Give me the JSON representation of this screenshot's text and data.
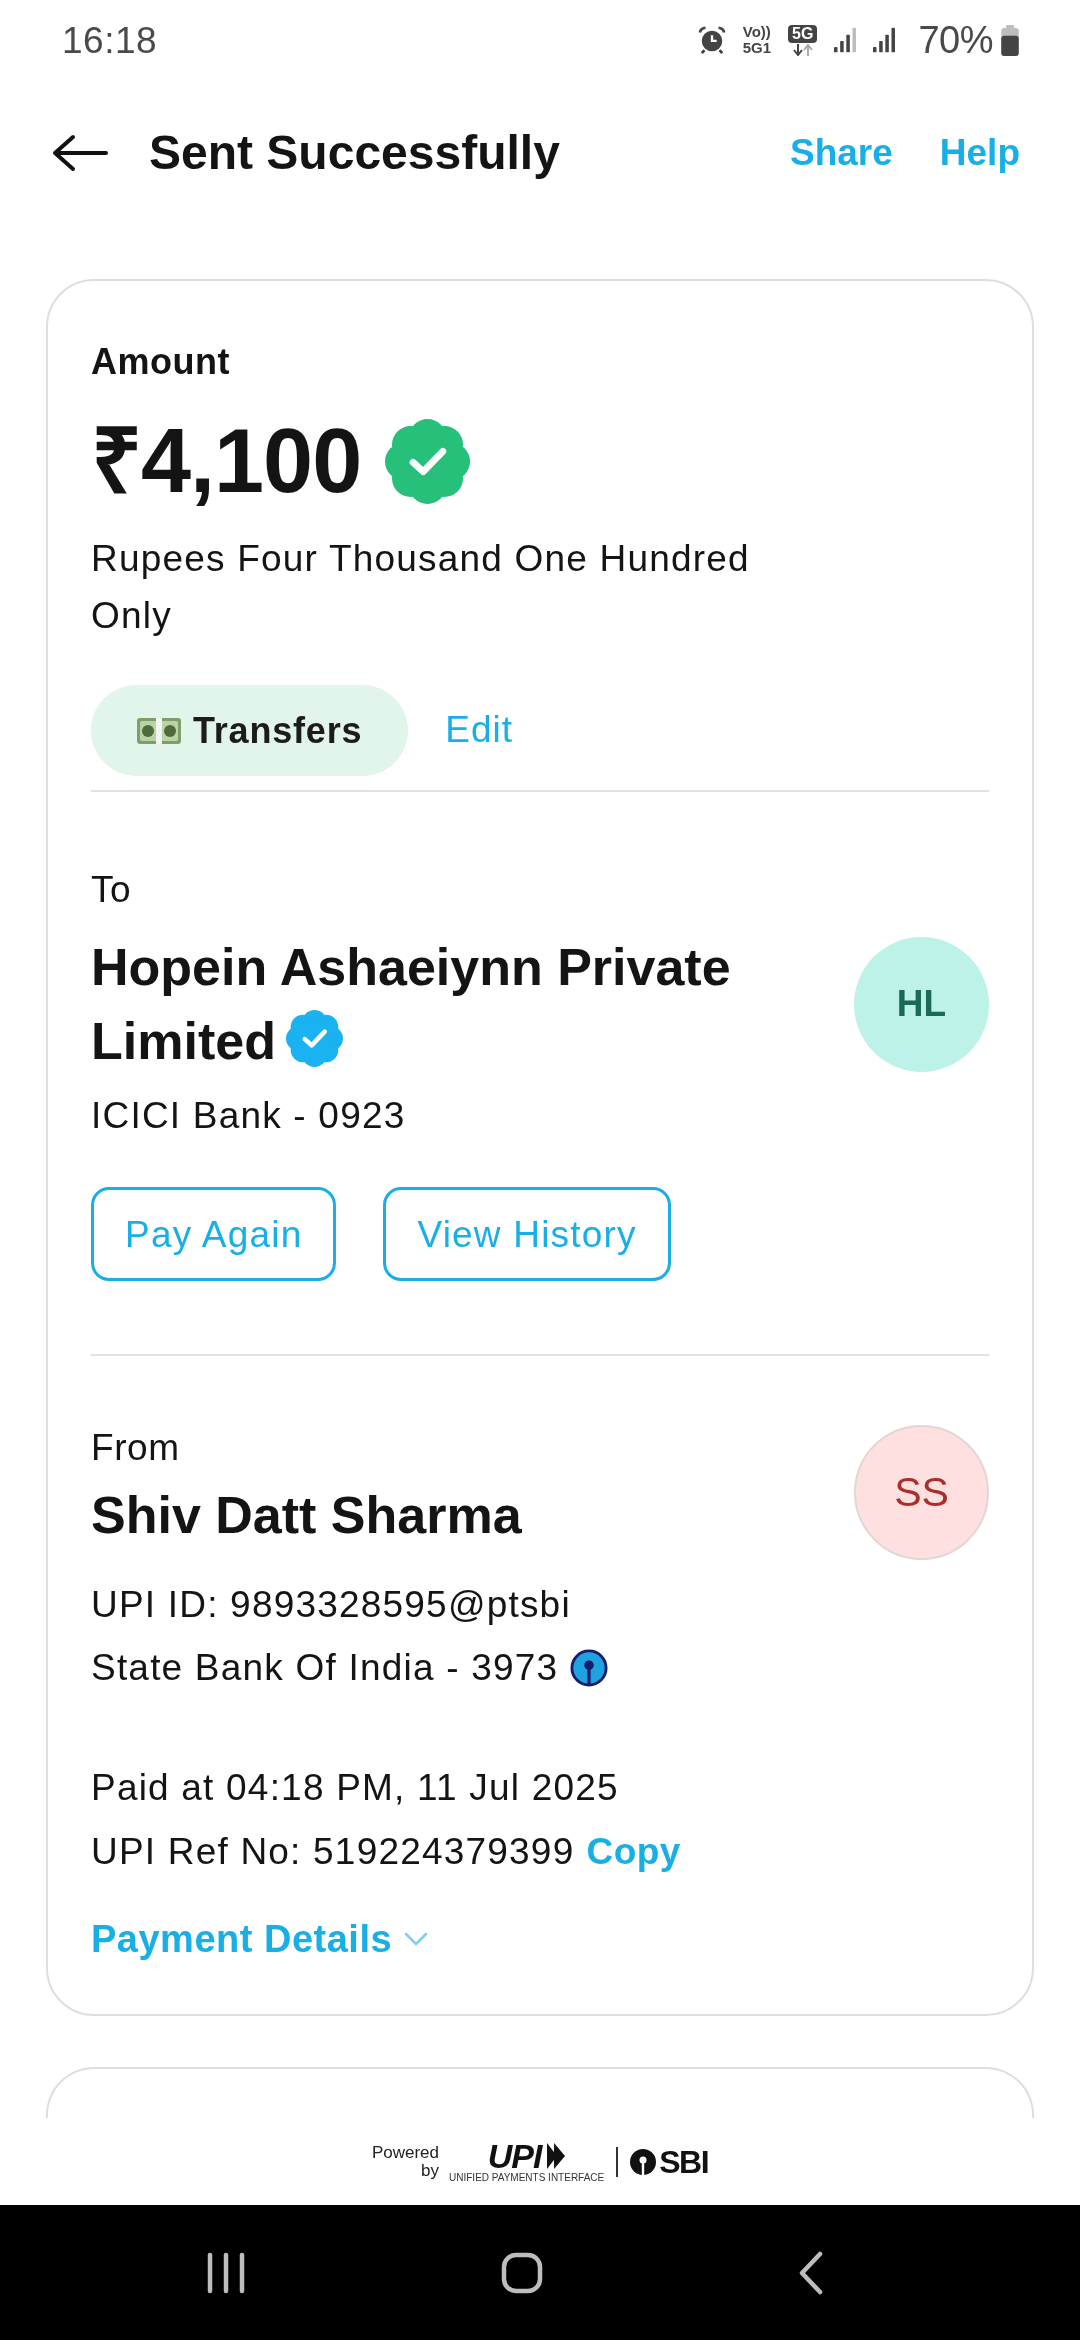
{
  "status_bar": {
    "time": "16:18",
    "volte": [
      "Vo))",
      "5G1"
    ],
    "network": "5G",
    "battery": "70%"
  },
  "header": {
    "title": "Sent Successfully",
    "actions": [
      "Share",
      "Help"
    ]
  },
  "amount": {
    "label": "Amount",
    "value": "₹4,100",
    "verified": true,
    "in_words": "Rupees Four Thousand One Hundred Only",
    "category": "Transfers",
    "edit": "Edit"
  },
  "to": {
    "label": "To",
    "name": "Hopein Ashaeiynn Private Limited",
    "verified": true,
    "initials": "HL",
    "bank": "ICICI Bank - 0923",
    "buttons": [
      "Pay Again",
      "View History"
    ]
  },
  "from": {
    "label": "From",
    "name": "Shiv Datt Sharma",
    "initials": "SS",
    "upi_id": "UPI ID: 9893328595@ptsbi",
    "bank": "State Bank Of India - 3973"
  },
  "details": {
    "paid_at": "Paid at 04:18 PM, 11 Jul 2025",
    "reference": "UPI Ref No: 519224379399",
    "copy": "Copy",
    "payment_details": {
      "label": "Payment Details",
      "expanded": false
    }
  },
  "footer": {
    "powered_by": "Powered by",
    "upi": "UPI",
    "upi_tagline": "UNIFIED PAYMENTS INTERFACE",
    "bank": "SBI"
  }
}
